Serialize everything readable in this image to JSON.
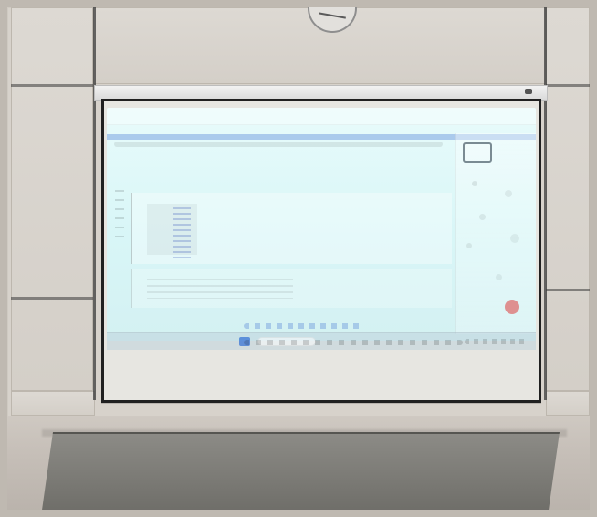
{
  "scene": {
    "subject": "projector-screen-in-room",
    "screen_content": "notebook-interface-projected",
    "icons": {
      "wall-clock": "clock-icon",
      "projector-housing": "projector-housing-icon",
      "taskbar-start": "start-icon",
      "taskbar-search": "search-icon"
    }
  }
}
